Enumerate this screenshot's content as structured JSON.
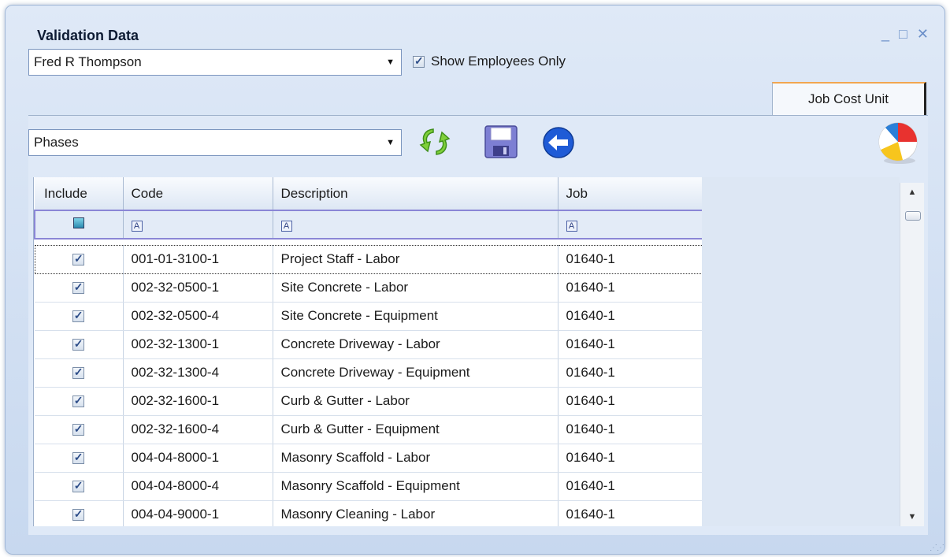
{
  "window": {
    "title": "Validation Data"
  },
  "employee_select": {
    "value": "Fred R Thompson"
  },
  "show_employees_only": {
    "label": "Show Employees Only",
    "checked": true
  },
  "tabs": [
    {
      "label": "Job Cost Unit",
      "active": true
    }
  ],
  "phase_select": {
    "value": "Phases"
  },
  "toolbar": {
    "icons": [
      "refresh-icon",
      "save-icon",
      "back-icon",
      "beach-ball-icon"
    ]
  },
  "grid": {
    "columns": [
      "Include",
      "Code",
      "Description",
      "Job"
    ],
    "rows": [
      {
        "include": true,
        "code": "001-01-3100-1",
        "description": "Project Staff - Labor",
        "job": "01640-1"
      },
      {
        "include": true,
        "code": "002-32-0500-1",
        "description": "Site Concrete - Labor",
        "job": "01640-1"
      },
      {
        "include": true,
        "code": "002-32-0500-4",
        "description": "Site Concrete - Equipment",
        "job": "01640-1"
      },
      {
        "include": true,
        "code": "002-32-1300-1",
        "description": "Concrete Driveway - Labor",
        "job": "01640-1"
      },
      {
        "include": true,
        "code": "002-32-1300-4",
        "description": "Concrete Driveway - Equipment",
        "job": "01640-1"
      },
      {
        "include": true,
        "code": "002-32-1600-1",
        "description": "Curb & Gutter - Labor",
        "job": "01640-1"
      },
      {
        "include": true,
        "code": "002-32-1600-4",
        "description": "Curb & Gutter - Equipment",
        "job": "01640-1"
      },
      {
        "include": true,
        "code": "004-04-8000-1",
        "description": "Masonry Scaffold - Labor",
        "job": "01640-1"
      },
      {
        "include": true,
        "code": "004-04-8000-4",
        "description": "Masonry Scaffold - Equipment",
        "job": "01640-1"
      },
      {
        "include": true,
        "code": "004-04-9000-1",
        "description": "Masonry Cleaning - Labor",
        "job": "01640-1"
      }
    ]
  },
  "colors": {
    "accent": "#f2a650",
    "filter_border": "#8a86d6",
    "window_bg": "#c7d8ef"
  }
}
